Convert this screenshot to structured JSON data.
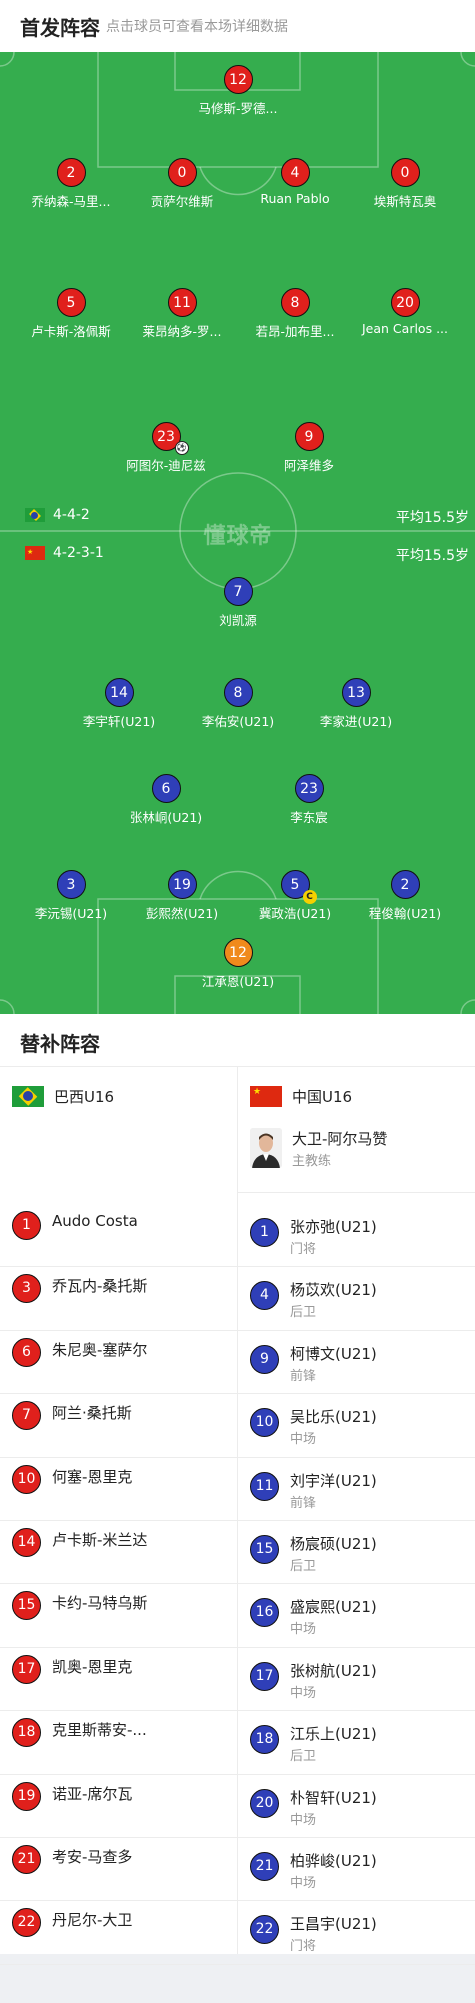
{
  "header": {
    "title": "首发阵容",
    "subtitle": "点击球员可查看本场详细数据"
  },
  "pitch": {
    "watermark": "懂球帝",
    "home": {
      "formation": "4-4-2",
      "avg_age": "平均15.5岁"
    },
    "away": {
      "formation": "4-2-3-1",
      "avg_age": "平均15.5岁"
    },
    "home_players": [
      {
        "num": "12",
        "name": "马修斯-罗德..."
      },
      {
        "num": "2",
        "name": "乔纳森-马里..."
      },
      {
        "num": "0",
        "name": "贡萨尔维斯"
      },
      {
        "num": "4",
        "name": "Ruan Pablo"
      },
      {
        "num": "0",
        "name": "埃斯特瓦奥"
      },
      {
        "num": "5",
        "name": "卢卡斯-洛佩斯"
      },
      {
        "num": "11",
        "name": "莱昂纳多-罗..."
      },
      {
        "num": "8",
        "name": "若昂-加布里..."
      },
      {
        "num": "20",
        "name": "Jean Carlos ..."
      },
      {
        "num": "23",
        "name": "阿图尔-迪尼兹"
      },
      {
        "num": "9",
        "name": "阿泽维多"
      }
    ],
    "away_players": [
      {
        "num": "7",
        "name": "刘凯源"
      },
      {
        "num": "14",
        "name": "李宇轩(U21)"
      },
      {
        "num": "8",
        "name": "李佑安(U21)"
      },
      {
        "num": "13",
        "name": "李家进(U21)"
      },
      {
        "num": "6",
        "name": "张林峒(U21)"
      },
      {
        "num": "23",
        "name": "李东宸"
      },
      {
        "num": "3",
        "name": "李沅锡(U21)"
      },
      {
        "num": "19",
        "name": "彭熙然(U21)"
      },
      {
        "num": "5",
        "name": "冀政浩(U21)"
      },
      {
        "num": "2",
        "name": "程俊翰(U21)"
      },
      {
        "num": "12",
        "name": "江承恩(U21)"
      }
    ],
    "captain_badge": "C",
    "ball_icon": "soccer-ball-icon"
  },
  "subs": {
    "title": "替补阵容",
    "home_team": "巴西U16",
    "away_team": "中国U16",
    "coach": {
      "name": "大卫-阿尔马赞",
      "role": "主教练"
    },
    "home": [
      {
        "num": "1",
        "name": "Audo Costa"
      },
      {
        "num": "3",
        "name": "乔瓦内-桑托斯"
      },
      {
        "num": "6",
        "name": "朱尼奥-塞萨尔"
      },
      {
        "num": "7",
        "name": "阿兰·桑托斯"
      },
      {
        "num": "10",
        "name": "何塞-恩里克"
      },
      {
        "num": "14",
        "name": "卢卡斯-米兰达"
      },
      {
        "num": "15",
        "name": "卡约-马特乌斯"
      },
      {
        "num": "17",
        "name": "凯奥-恩里克"
      },
      {
        "num": "18",
        "name": "克里斯蒂安-..."
      },
      {
        "num": "19",
        "name": "诺亚-席尔瓦"
      },
      {
        "num": "21",
        "name": "考安-马查多"
      },
      {
        "num": "22",
        "name": "丹尼尔-大卫"
      }
    ],
    "away": [
      {
        "num": "1",
        "name": "张亦弛(U21)",
        "pos": "门将"
      },
      {
        "num": "4",
        "name": "杨苡欢(U21)",
        "pos": "后卫"
      },
      {
        "num": "9",
        "name": "柯博文(U21)",
        "pos": "前锋"
      },
      {
        "num": "10",
        "name": "吴比乐(U21)",
        "pos": "中场"
      },
      {
        "num": "11",
        "name": "刘宇洋(U21)",
        "pos": "前锋"
      },
      {
        "num": "15",
        "name": "杨宸硕(U21)",
        "pos": "后卫"
      },
      {
        "num": "16",
        "name": "盛宸熙(U21)",
        "pos": "中场"
      },
      {
        "num": "17",
        "name": "张树航(U21)",
        "pos": "中场"
      },
      {
        "num": "18",
        "name": "江乐上(U21)",
        "pos": "后卫"
      },
      {
        "num": "20",
        "name": "朴智轩(U21)",
        "pos": "中场"
      },
      {
        "num": "21",
        "name": "柏骅峻(U21)",
        "pos": "中场"
      },
      {
        "num": "22",
        "name": "王昌宇(U21)",
        "pos": "门将"
      }
    ]
  },
  "colors": {
    "pitch": "#35ad4e",
    "home": "#e0201c",
    "away": "#2f3fb8",
    "keeper": "#f08a1c"
  }
}
